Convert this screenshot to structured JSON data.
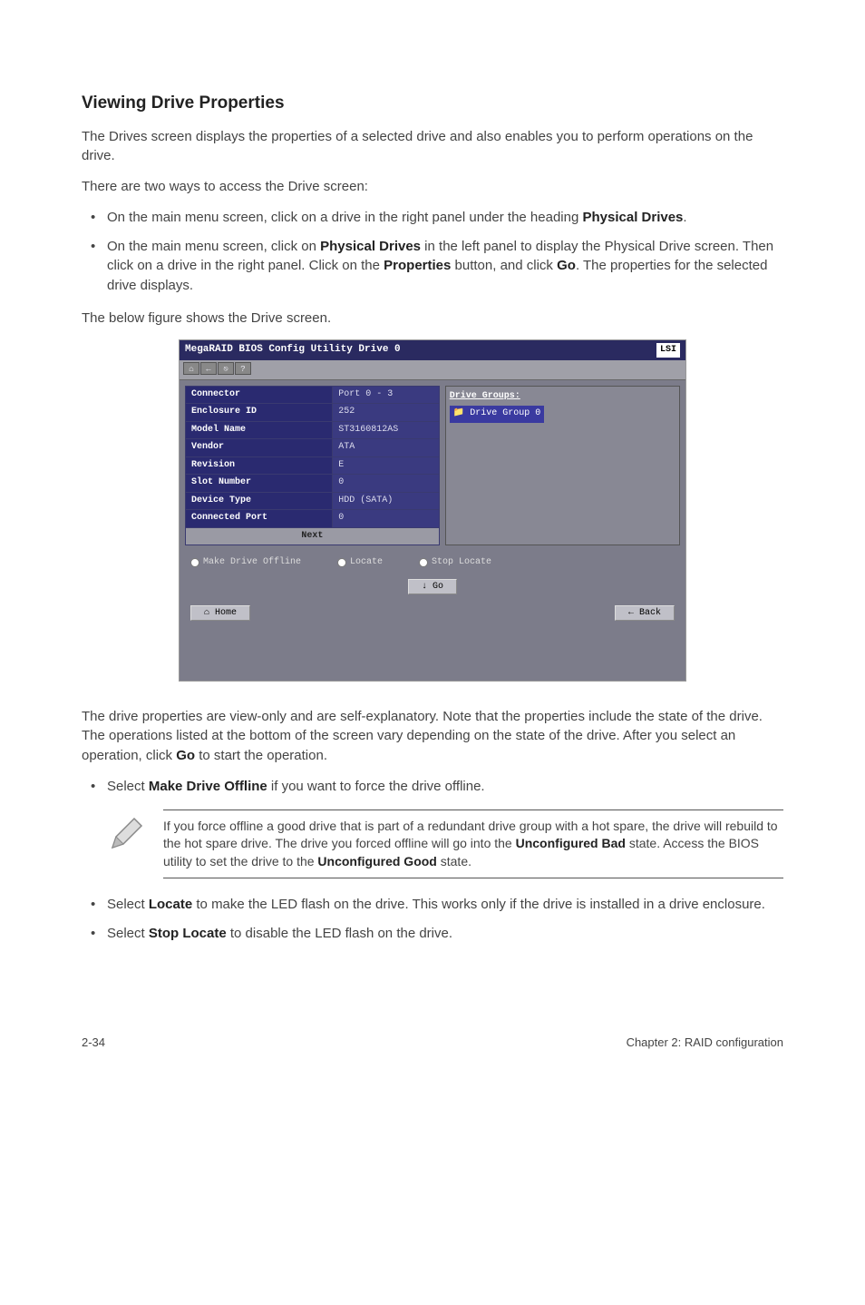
{
  "heading": "Viewing Drive Properties",
  "intro1": "The Drives screen displays the properties of a selected drive and also enables you to perform operations on the drive.",
  "intro2": "There are two ways to access the Drive screen:",
  "bullets1": [
    {
      "pre": "On the main menu screen, click on a drive in the right panel under the heading ",
      "b": "Physical Drives",
      "post": "."
    },
    {
      "pre": "On the main menu screen, click on ",
      "b": "Physical Drives",
      "post": " in the left panel to display the Physical Drive screen. Then click on a drive in the right panel. Click on the ",
      "b2": "Properties",
      "post2": " button, and click ",
      "b3": "Go",
      "post3": ". The properties for the selected drive displays."
    }
  ],
  "caption1": "The below figure shows the Drive screen.",
  "screenshot": {
    "title": "MegaRAID BIOS Config Utility Drive 0",
    "logo": "LSI",
    "props": [
      {
        "label": "Connector",
        "value": "Port 0 - 3"
      },
      {
        "label": "Enclosure ID",
        "value": "252"
      },
      {
        "label": "Model Name",
        "value": "ST3160812AS"
      },
      {
        "label": "Vendor",
        "value": "ATA"
      },
      {
        "label": "Revision",
        "value": "E"
      },
      {
        "label": "Slot Number",
        "value": "0"
      },
      {
        "label": "Device Type",
        "value": "HDD (SATA)"
      },
      {
        "label": "Connected Port",
        "value": "0"
      }
    ],
    "next": "Next",
    "dgHeader": "Drive Groups:",
    "dgItem": "Drive Group 0",
    "radios": [
      "Make Drive Offline",
      "Locate",
      "Stop Locate"
    ],
    "go": "Go",
    "home": "Home",
    "back": "Back"
  },
  "para2_parts": {
    "p1": "The drive properties are view-only and are self-explanatory. Note that the properties include the state of the drive. The operations listed at the bottom of the screen vary depending on the state of the drive. After you select an operation, click ",
    "b1": "Go",
    "p2": " to start the operation."
  },
  "bullets2": [
    {
      "pre": "Select ",
      "b": "Make Drive Offline",
      "post": " if you want to force the drive offline."
    }
  ],
  "note": {
    "p1": "If you force offline a good drive that is part of a redundant drive group with a hot spare, the drive will rebuild to the hot spare drive. The drive you forced offline will go into the ",
    "b1": "Unconfigured Bad",
    "p2": " state. Access the BIOS utility to set the drive to the ",
    "b2": "Unconfigured Good",
    "p3": " state."
  },
  "bullets3": [
    {
      "pre": "Select ",
      "b": "Locate",
      "post": " to make the LED flash on the drive. This works only if the drive is installed in a drive enclosure."
    },
    {
      "pre": "Select ",
      "b": "Stop Locate",
      "post": " to disable the LED flash on the drive."
    }
  ],
  "footer": {
    "left": "2-34",
    "right": "Chapter 2: RAID configuration"
  }
}
